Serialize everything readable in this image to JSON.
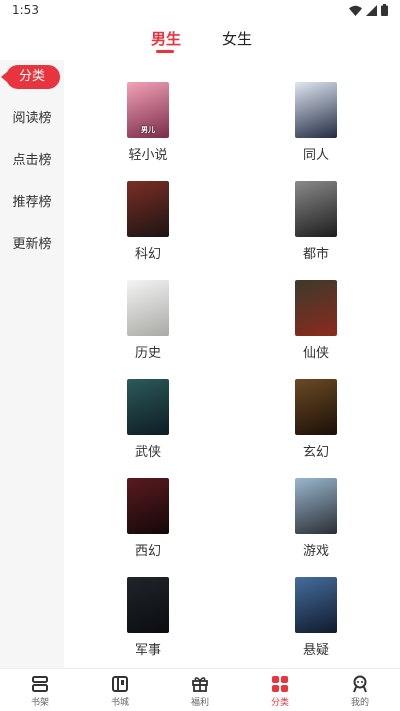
{
  "status_bar": {
    "time": "1:53",
    "icons": [
      "wifi-icon",
      "signal-icon",
      "battery-icon"
    ]
  },
  "gender_tabs": [
    {
      "label": "男生",
      "selected": true
    },
    {
      "label": "女生",
      "selected": false
    }
  ],
  "rank_nav": {
    "items": [
      {
        "label": "分类",
        "selected": true
      },
      {
        "label": "阅读榜",
        "selected": false
      },
      {
        "label": "点击榜",
        "selected": false
      },
      {
        "label": "推荐榜",
        "selected": false
      },
      {
        "label": "更新榜",
        "selected": false
      }
    ]
  },
  "categories": [
    {
      "label": "轻小说",
      "cover_text": "男儿",
      "cover_colors": [
        "#f2a3b8",
        "#7a2b49"
      ]
    },
    {
      "label": "同人",
      "cover_text": "",
      "cover_colors": [
        "#dfe7f2",
        "#232b44"
      ]
    },
    {
      "label": "科幻",
      "cover_text": "",
      "cover_colors": [
        "#7b2e24",
        "#1c1414"
      ]
    },
    {
      "label": "都市",
      "cover_text": "",
      "cover_colors": [
        "#8a8a8a",
        "#1d1d1d"
      ]
    },
    {
      "label": "历史",
      "cover_text": "",
      "cover_colors": [
        "#f4f4f2",
        "#a9a9a6"
      ]
    },
    {
      "label": "仙侠",
      "cover_text": "",
      "cover_colors": [
        "#3c3a2a",
        "#8c2a1e"
      ]
    },
    {
      "label": "武侠",
      "cover_text": "",
      "cover_colors": [
        "#2c5a5a",
        "#0d1c24"
      ]
    },
    {
      "label": "玄幻",
      "cover_text": "",
      "cover_colors": [
        "#6a4a24",
        "#1b0f08"
      ]
    },
    {
      "label": "西幻",
      "cover_text": "",
      "cover_colors": [
        "#5a1a20",
        "#140808"
      ]
    },
    {
      "label": "游戏",
      "cover_text": "",
      "cover_colors": [
        "#9ab7cf",
        "#2a2e34"
      ]
    },
    {
      "label": "军事",
      "cover_text": "",
      "cover_colors": [
        "#20252b",
        "#0a0c10"
      ]
    },
    {
      "label": "悬疑",
      "cover_text": "",
      "cover_colors": [
        "#466d9c",
        "#0f1a2c"
      ]
    }
  ],
  "bottom_nav": [
    {
      "label": "书架",
      "icon": "bookshelf-icon",
      "selected": false
    },
    {
      "label": "书城",
      "icon": "bookstore-icon",
      "selected": false
    },
    {
      "label": "福利",
      "icon": "gift-icon",
      "selected": false
    },
    {
      "label": "分类",
      "icon": "category-icon",
      "selected": true
    },
    {
      "label": "我的",
      "icon": "profile-icon",
      "selected": false
    }
  ],
  "colors": {
    "accent": "#e8343f",
    "nav_bg": "#f6f6f6"
  }
}
